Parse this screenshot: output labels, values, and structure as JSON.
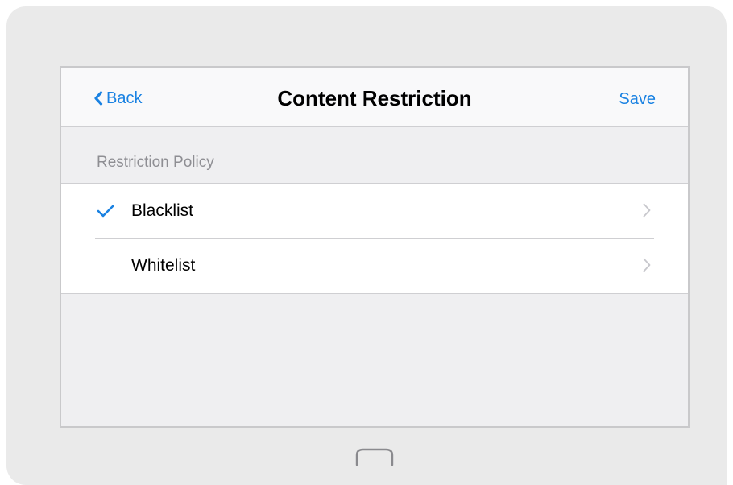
{
  "nav": {
    "back_label": "Back",
    "title": "Content Restriction",
    "save_label": "Save"
  },
  "section": {
    "header": "Restriction Policy"
  },
  "policies": [
    {
      "label": "Blacklist",
      "selected": true
    },
    {
      "label": "Whitelist",
      "selected": false
    }
  ],
  "colors": {
    "accent": "#1a82e2",
    "chevron": "#c7c7cc",
    "frame": "#eaeaea",
    "screen_bg": "#efeff1"
  },
  "icons": {
    "back": "chevron-left-icon",
    "selected": "checkmark-icon",
    "disclosure": "chevron-right-icon",
    "home": "home-button-icon"
  }
}
